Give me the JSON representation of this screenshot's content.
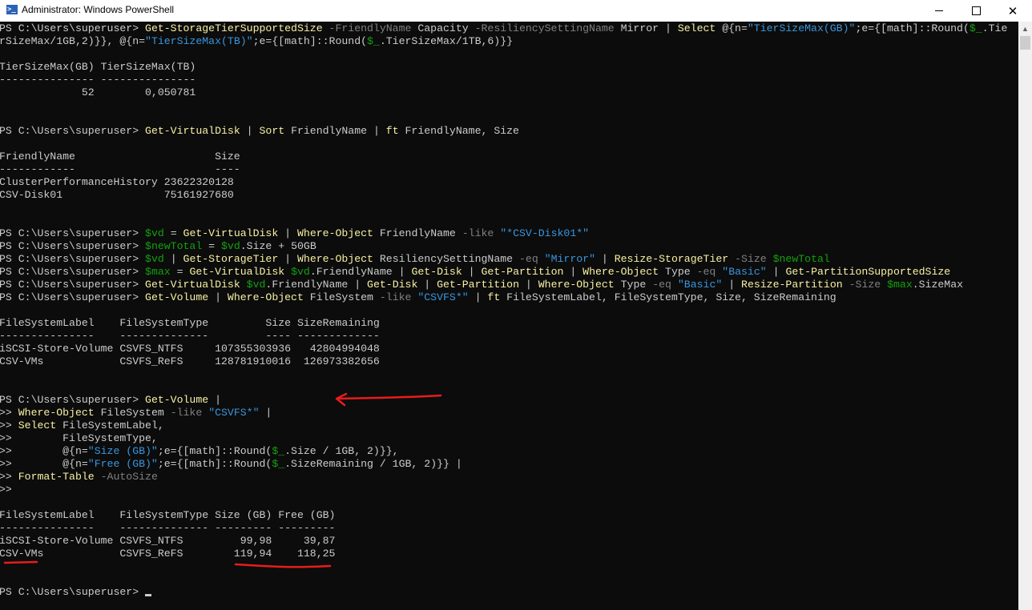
{
  "window": {
    "title": "Administrator: Windows PowerShell",
    "icon": "powershell-icon",
    "minimize": "minimize-icon",
    "maximize": "maximize-icon",
    "close": "close-icon",
    "close_glyph": "✕"
  },
  "colors": {
    "background": "#0c0c0c",
    "text": "#cccccc",
    "cmdlet": "#f9f1a5",
    "parameter": "#808080",
    "string": "#3a96dd",
    "variable": "#13a10e",
    "annotation": "#e81c1c"
  },
  "scrollbar": {
    "up_arrow": "▲"
  },
  "console": {
    "lines": [
      [
        {
          "k": "p",
          "t": "PS C:\\Users\\superuser> "
        },
        {
          "k": "c",
          "t": "Get-StorageTierSupportedSize"
        },
        {
          "k": "p",
          "t": " "
        },
        {
          "k": "a",
          "t": "-FriendlyName"
        },
        {
          "k": "p",
          "t": " Capacity "
        },
        {
          "k": "a",
          "t": "-ResiliencySettingName"
        },
        {
          "k": "p",
          "t": " Mirror | "
        },
        {
          "k": "c",
          "t": "Select"
        },
        {
          "k": "p",
          "t": " @{n="
        },
        {
          "k": "s",
          "t": "\"TierSizeMax(GB)\""
        },
        {
          "k": "p",
          "t": ";e={[math]::Round("
        },
        {
          "k": "v",
          "t": "$_"
        },
        {
          "k": "p",
          "t": ".Tie"
        }
      ],
      [
        {
          "k": "p",
          "t": "rSizeMax/1GB,2)}}, @{n="
        },
        {
          "k": "s",
          "t": "\"TierSizeMax(TB)\""
        },
        {
          "k": "p",
          "t": ";e={[math]::Round("
        },
        {
          "k": "v",
          "t": "$_"
        },
        {
          "k": "p",
          "t": ".TierSizeMax/1TB,6)}}"
        }
      ],
      [],
      [
        {
          "k": "p",
          "t": "TierSizeMax(GB) TierSizeMax(TB)"
        }
      ],
      [
        {
          "k": "p",
          "t": "--------------- ---------------"
        }
      ],
      [
        {
          "k": "p",
          "t": "             52        0,050781"
        }
      ],
      [],
      [],
      [
        {
          "k": "p",
          "t": "PS C:\\Users\\superuser> "
        },
        {
          "k": "c",
          "t": "Get-VirtualDisk"
        },
        {
          "k": "p",
          "t": " | "
        },
        {
          "k": "c",
          "t": "Sort"
        },
        {
          "k": "p",
          "t": " FriendlyName | "
        },
        {
          "k": "c",
          "t": "ft"
        },
        {
          "k": "p",
          "t": " FriendlyName, Size"
        }
      ],
      [],
      [
        {
          "k": "p",
          "t": "FriendlyName                      Size"
        }
      ],
      [
        {
          "k": "p",
          "t": "------------                      ----"
        }
      ],
      [
        {
          "k": "p",
          "t": "ClusterPerformanceHistory 23622320128"
        }
      ],
      [
        {
          "k": "p",
          "t": "CSV-Disk01                75161927680"
        }
      ],
      [],
      [],
      [
        {
          "k": "p",
          "t": "PS C:\\Users\\superuser> "
        },
        {
          "k": "v",
          "t": "$vd"
        },
        {
          "k": "p",
          "t": " = "
        },
        {
          "k": "c",
          "t": "Get-VirtualDisk"
        },
        {
          "k": "p",
          "t": " | "
        },
        {
          "k": "c",
          "t": "Where-Object"
        },
        {
          "k": "p",
          "t": " FriendlyName "
        },
        {
          "k": "a",
          "t": "-like"
        },
        {
          "k": "p",
          "t": " "
        },
        {
          "k": "s",
          "t": "\"*CSV-Disk01*\""
        }
      ],
      [
        {
          "k": "p",
          "t": "PS C:\\Users\\superuser> "
        },
        {
          "k": "v",
          "t": "$newTotal"
        },
        {
          "k": "p",
          "t": " = "
        },
        {
          "k": "v",
          "t": "$vd"
        },
        {
          "k": "p",
          "t": ".Size + 50GB"
        }
      ],
      [
        {
          "k": "p",
          "t": "PS C:\\Users\\superuser> "
        },
        {
          "k": "v",
          "t": "$vd"
        },
        {
          "k": "p",
          "t": " | "
        },
        {
          "k": "c",
          "t": "Get-StorageTier"
        },
        {
          "k": "p",
          "t": " | "
        },
        {
          "k": "c",
          "t": "Where-Object"
        },
        {
          "k": "p",
          "t": " ResiliencySettingName "
        },
        {
          "k": "a",
          "t": "-eq"
        },
        {
          "k": "p",
          "t": " "
        },
        {
          "k": "s",
          "t": "\"Mirror\""
        },
        {
          "k": "p",
          "t": " | "
        },
        {
          "k": "c",
          "t": "Resize-StorageTier"
        },
        {
          "k": "p",
          "t": " "
        },
        {
          "k": "a",
          "t": "-Size"
        },
        {
          "k": "p",
          "t": " "
        },
        {
          "k": "v",
          "t": "$newTotal"
        }
      ],
      [
        {
          "k": "p",
          "t": "PS C:\\Users\\superuser> "
        },
        {
          "k": "v",
          "t": "$max"
        },
        {
          "k": "p",
          "t": " = "
        },
        {
          "k": "c",
          "t": "Get-VirtualDisk"
        },
        {
          "k": "p",
          "t": " "
        },
        {
          "k": "v",
          "t": "$vd"
        },
        {
          "k": "p",
          "t": ".FriendlyName | "
        },
        {
          "k": "c",
          "t": "Get-Disk"
        },
        {
          "k": "p",
          "t": " | "
        },
        {
          "k": "c",
          "t": "Get-Partition"
        },
        {
          "k": "p",
          "t": " | "
        },
        {
          "k": "c",
          "t": "Where-Object"
        },
        {
          "k": "p",
          "t": " Type "
        },
        {
          "k": "a",
          "t": "-eq"
        },
        {
          "k": "p",
          "t": " "
        },
        {
          "k": "s",
          "t": "\"Basic\""
        },
        {
          "k": "p",
          "t": " | "
        },
        {
          "k": "c",
          "t": "Get-PartitionSupportedSize"
        }
      ],
      [
        {
          "k": "p",
          "t": "PS C:\\Users\\superuser> "
        },
        {
          "k": "c",
          "t": "Get-VirtualDisk"
        },
        {
          "k": "p",
          "t": " "
        },
        {
          "k": "v",
          "t": "$vd"
        },
        {
          "k": "p",
          "t": ".FriendlyName | "
        },
        {
          "k": "c",
          "t": "Get-Disk"
        },
        {
          "k": "p",
          "t": " | "
        },
        {
          "k": "c",
          "t": "Get-Partition"
        },
        {
          "k": "p",
          "t": " | "
        },
        {
          "k": "c",
          "t": "Where-Object"
        },
        {
          "k": "p",
          "t": " Type "
        },
        {
          "k": "a",
          "t": "-eq"
        },
        {
          "k": "p",
          "t": " "
        },
        {
          "k": "s",
          "t": "\"Basic\""
        },
        {
          "k": "p",
          "t": " | "
        },
        {
          "k": "c",
          "t": "Resize-Partition"
        },
        {
          "k": "p",
          "t": " "
        },
        {
          "k": "a",
          "t": "-Size"
        },
        {
          "k": "p",
          "t": " "
        },
        {
          "k": "v",
          "t": "$max"
        },
        {
          "k": "p",
          "t": ".SizeMax"
        }
      ],
      [
        {
          "k": "p",
          "t": "PS C:\\Users\\superuser> "
        },
        {
          "k": "c",
          "t": "Get-Volume"
        },
        {
          "k": "p",
          "t": " | "
        },
        {
          "k": "c",
          "t": "Where-Object"
        },
        {
          "k": "p",
          "t": " FileSystem "
        },
        {
          "k": "a",
          "t": "-like"
        },
        {
          "k": "p",
          "t": " "
        },
        {
          "k": "s",
          "t": "\"CSVFS*\""
        },
        {
          "k": "p",
          "t": " | "
        },
        {
          "k": "c",
          "t": "ft"
        },
        {
          "k": "p",
          "t": " FileSystemLabel, FileSystemType, Size, SizeRemaining"
        }
      ],
      [],
      [
        {
          "k": "p",
          "t": "FileSystemLabel    FileSystemType         Size SizeRemaining"
        }
      ],
      [
        {
          "k": "p",
          "t": "---------------    --------------         ---- -------------"
        }
      ],
      [
        {
          "k": "p",
          "t": "iSCSI-Store-Volume CSVFS_NTFS     107355303936   42804994048"
        }
      ],
      [
        {
          "k": "p",
          "t": "CSV-VMs            CSVFS_ReFS     128781910016  126973382656"
        }
      ],
      [],
      [],
      [
        {
          "k": "p",
          "t": "PS C:\\Users\\superuser> "
        },
        {
          "k": "c",
          "t": "Get-Volume"
        },
        {
          "k": "p",
          "t": " |"
        }
      ],
      [
        {
          "k": "p",
          "t": ">> "
        },
        {
          "k": "c",
          "t": "Where-Object"
        },
        {
          "k": "p",
          "t": " FileSystem "
        },
        {
          "k": "a",
          "t": "-like"
        },
        {
          "k": "p",
          "t": " "
        },
        {
          "k": "s",
          "t": "\"CSVFS*\""
        },
        {
          "k": "p",
          "t": " |"
        }
      ],
      [
        {
          "k": "p",
          "t": ">> "
        },
        {
          "k": "c",
          "t": "Select"
        },
        {
          "k": "p",
          "t": " FileSystemLabel,"
        }
      ],
      [
        {
          "k": "p",
          "t": ">>        FileSystemType,"
        }
      ],
      [
        {
          "k": "p",
          "t": ">>        @{n="
        },
        {
          "k": "s",
          "t": "\"Size (GB)\""
        },
        {
          "k": "p",
          "t": ";e={[math]::Round("
        },
        {
          "k": "v",
          "t": "$_"
        },
        {
          "k": "p",
          "t": ".Size / 1GB, 2)}},"
        }
      ],
      [
        {
          "k": "p",
          "t": ">>        @{n="
        },
        {
          "k": "s",
          "t": "\"Free (GB)\""
        },
        {
          "k": "p",
          "t": ";e={[math]::Round("
        },
        {
          "k": "v",
          "t": "$_"
        },
        {
          "k": "p",
          "t": ".SizeRemaining / 1GB, 2)}} |"
        }
      ],
      [
        {
          "k": "p",
          "t": ">> "
        },
        {
          "k": "c",
          "t": "Format-Table"
        },
        {
          "k": "p",
          "t": " "
        },
        {
          "k": "a",
          "t": "-AutoSize"
        }
      ],
      [
        {
          "k": "p",
          "t": ">>"
        }
      ],
      [],
      [
        {
          "k": "p",
          "t": "FileSystemLabel    FileSystemType Size (GB) Free (GB)"
        }
      ],
      [
        {
          "k": "p",
          "t": "---------------    -------------- --------- ---------"
        }
      ],
      [
        {
          "k": "p",
          "t": "iSCSI-Store-Volume CSVFS_NTFS         99,98     39,87"
        }
      ],
      [
        {
          "k": "p",
          "t": "CSV-VMs            CSVFS_ReFS        119,94    118,25"
        }
      ],
      [],
      [],
      [
        {
          "k": "p",
          "t": "PS C:\\Users\\superuser> "
        }
      ]
    ]
  }
}
